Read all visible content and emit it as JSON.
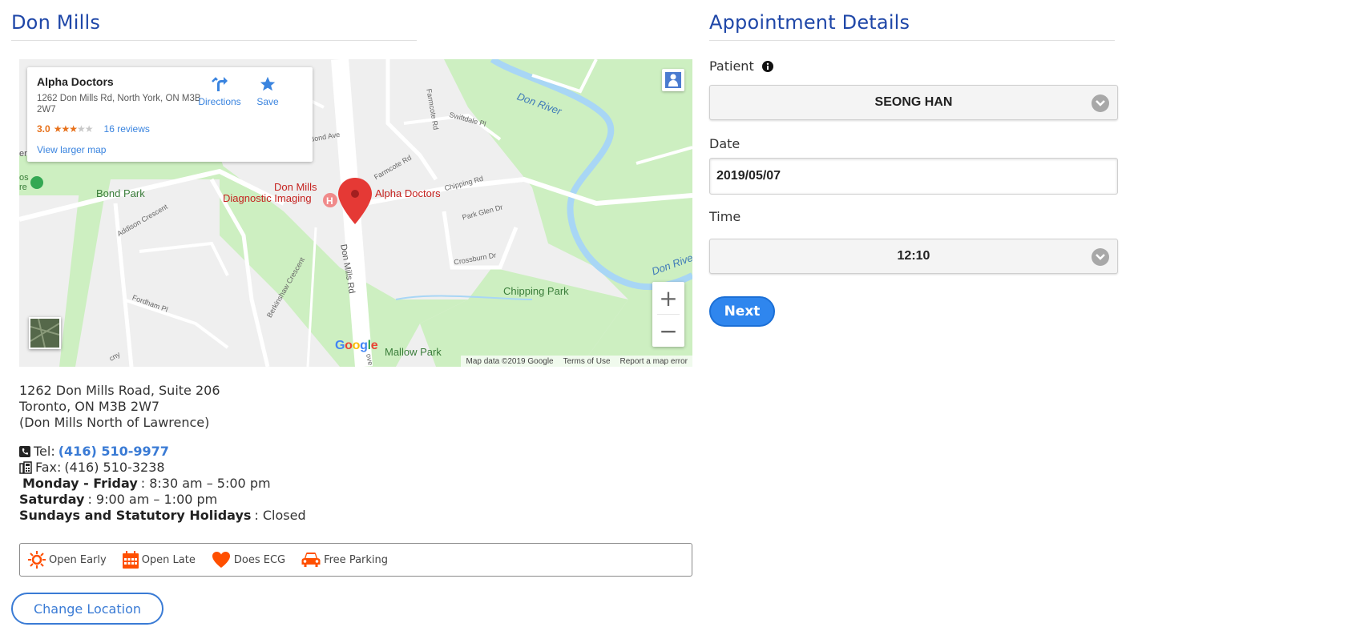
{
  "location": {
    "title": "Don Mills",
    "address_lines": [
      "1262 Don Mills Road, Suite 206",
      "Toronto, ON M3B 2W7",
      "(Don Mills North of Lawrence)"
    ],
    "tel_label": "Tel:",
    "tel": "(416) 510-9977",
    "fax_label": "Fax:",
    "fax": "(416) 510-3238",
    "hours": [
      {
        "day": "Monday - Friday",
        "time": ": 8:30 am – 5:00 pm"
      },
      {
        "day": "Saturday",
        "time": ": 9:00 am – 1:00 pm"
      },
      {
        "day": "Sundays and Statutory Holidays",
        "time": ": Closed"
      }
    ],
    "features": [
      {
        "label": "Open Early",
        "icon": "sun-icon"
      },
      {
        "label": "Open Late",
        "icon": "calendar-icon"
      },
      {
        "label": "Does ECG",
        "icon": "heart-icon"
      },
      {
        "label": "Free Parking",
        "icon": "car-icon"
      }
    ],
    "change_location_label": "Change Location",
    "accent_color": "#ff4f00"
  },
  "map": {
    "card": {
      "name": "Alpha Doctors",
      "address": "1262 Don Mills Rd, North York, ON M3B 2W7",
      "rating": "3.0",
      "stars_filled": 3,
      "stars_total": 5,
      "reviews": "16 reviews",
      "larger_map": "View larger map",
      "directions": "Directions",
      "save": "Save"
    },
    "labels": {
      "don_river_1": "Don River",
      "don_river_2": "Don River",
      "bond_park": "Bond Park",
      "chipping_park": "Chipping Park",
      "mallow_park": "Mallow Park",
      "don_mills_rd": "Don Mills Rd",
      "alpha_doctors": "Alpha Doctors",
      "diag_1": "Don Mills",
      "diag_2": "Diagnostic Imaging",
      "farmcote_rd": "Farmcote Rd",
      "farmcote_rd2": "Farmcote Rd",
      "swiftdale": "Swiftdale Pl",
      "chipping_rd": "Chipping Rd",
      "park_glen": "Park Glen Dr",
      "crossburn": "Crossburn Dr",
      "addison": "Addison Crescent",
      "fordham": "Fordham Pl",
      "berkinshaw": "Berkinshaw Crescent",
      "bond_ave": "Bond Ave",
      "edge_er": "er",
      "edge_os": "os",
      "edge_re": "re",
      "edge_cny": "cny",
      "edge_ove": "ove"
    },
    "google": [
      "G",
      "o",
      "o",
      "g",
      "l",
      "e"
    ],
    "footer": [
      "Map data ©2019 Google",
      "Terms of Use",
      "Report a map error"
    ],
    "zoom_in": "+",
    "zoom_out": "−"
  },
  "appointment": {
    "title": "Appointment Details",
    "patient_label": "Patient",
    "patient_value": "SEONG HAN",
    "date_label": "Date",
    "date_value": "2019/05/07",
    "time_label": "Time",
    "time_value": "12:10",
    "next_label": "Next",
    "primary_color": "#2f86ee"
  }
}
